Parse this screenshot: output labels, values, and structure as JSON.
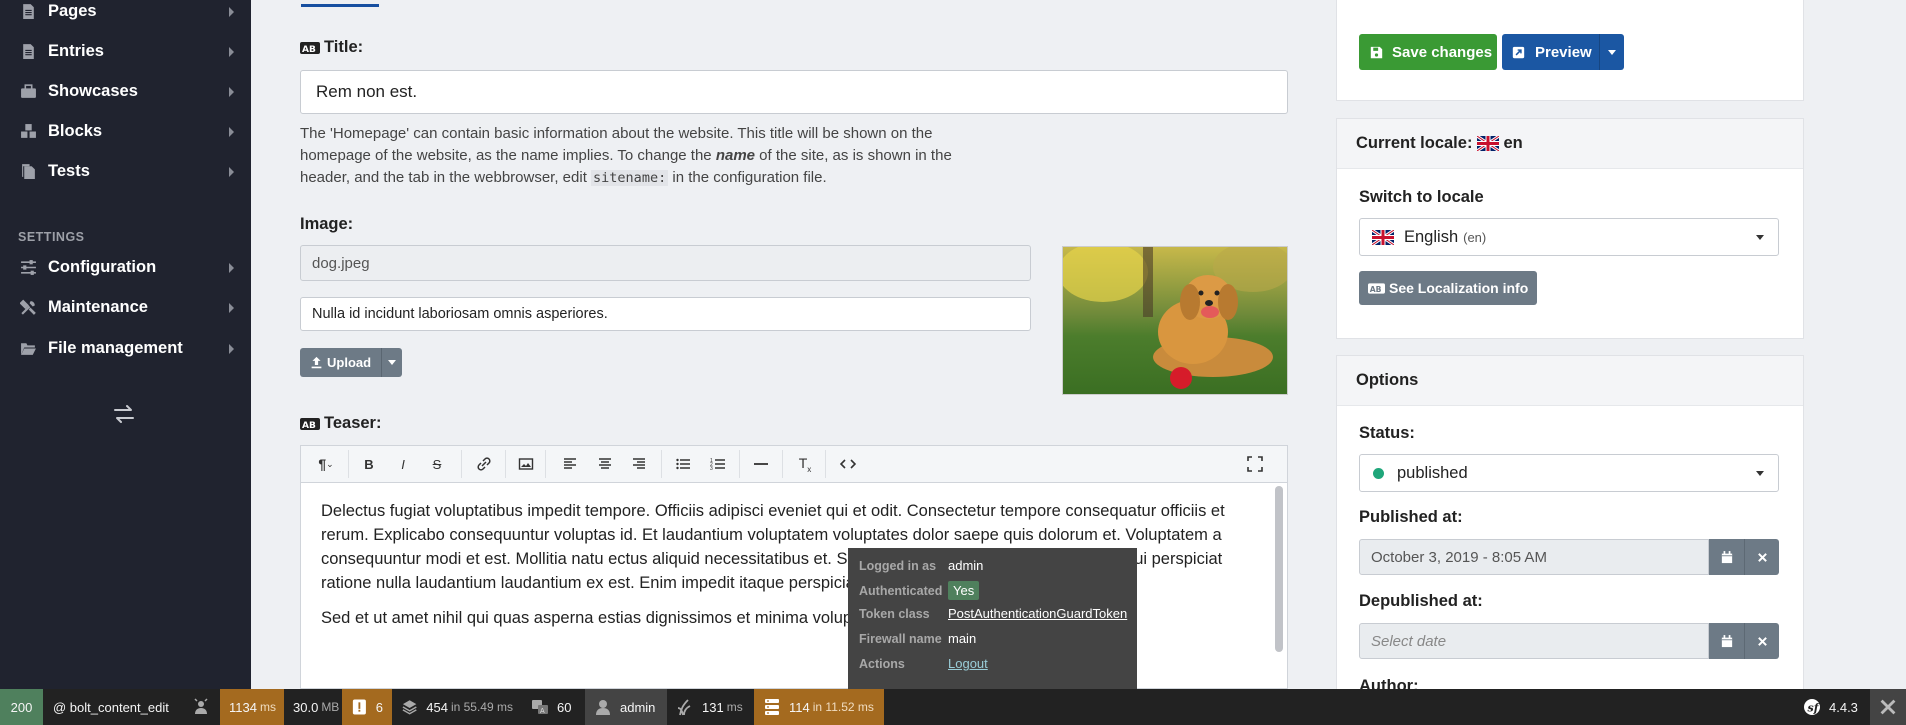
{
  "sidebar": {
    "items": [
      {
        "label": "Pages",
        "icon": "pages-icon"
      },
      {
        "label": "Entries",
        "icon": "entries-icon"
      },
      {
        "label": "Showcases",
        "icon": "showcases-icon"
      },
      {
        "label": "Blocks",
        "icon": "blocks-icon"
      },
      {
        "label": "Tests",
        "icon": "tests-icon"
      }
    ],
    "settings_header": "SETTINGS",
    "settings_items": [
      {
        "label": "Configuration",
        "icon": "sliders-icon"
      },
      {
        "label": "Maintenance",
        "icon": "tools-icon"
      },
      {
        "label": "File management",
        "icon": "folder-open-icon"
      }
    ]
  },
  "form": {
    "title_label": "Title:",
    "title_value": "Rem non est.",
    "help_parts": {
      "p1": "The 'Homepage' can contain basic information about the website. This title will be shown on the homepage of the website, as the name implies. To change the ",
      "em": "name",
      "p2": " of the site, as is shown in the header, and the tab in the webbrowser, edit ",
      "code": "sitename:",
      "p3": " in the configuration file."
    },
    "image_label": "Image:",
    "image_filename": "dog.jpeg",
    "image_alt": "Nulla id incidunt laboriosam omnis asperiores.",
    "upload_label": "Upload",
    "teaser_label": "Teaser:",
    "teaser_p1": "Delectus fugiat voluptatibus impedit tempore. Officiis adipisci eveniet qui et odit. Consectetur tempore consequatur officiis et rerum. Explicabo consequuntur voluptas id. Et laudantium voluptatem voluptates dolor saepe quis dolorum et. Voluptatem a consequuntur modi et est. Mollitia natu",
    "teaser_p1b": "ectus aliquid necessitatibus et. Sit est sit vero officia quam modi. Dicta qui perspiciat",
    "teaser_p1c": " ratione nulla laudantium laudantium ex est. Enim impedit itaque perspiciatis. Sit suscipit",
    "teaser_p2": "Sed et ut amet nihil qui quas asperna",
    "teaser_p2b": "estias dignissimos et minima voluptas praesentium ut officiis quia."
  },
  "actions": {
    "save_label": "Save changes",
    "preview_label": "Preview"
  },
  "locale": {
    "current_label": "Current locale:",
    "current_code": "en",
    "switch_label": "Switch to locale",
    "selected_language": "English",
    "selected_code": "(en)",
    "info_button": "See Localization info"
  },
  "options": {
    "header": "Options",
    "status_label": "Status:",
    "status_value": "published",
    "status_color": "#1fa67a",
    "published_label": "Published at:",
    "published_value": "October 3, 2019 - 8:05 AM",
    "depublished_label": "Depublished at:",
    "depublished_placeholder": "Select date",
    "author_label": "Author:"
  },
  "tooltip": {
    "rows": [
      {
        "key": "Logged in as",
        "value": "admin"
      },
      {
        "key": "Authenticated",
        "value": "Yes"
      },
      {
        "key": "Token class",
        "value": "PostAuthenticationGuardToken"
      },
      {
        "key": "Firewall name",
        "value": "main"
      },
      {
        "key": "Actions",
        "value": "Logout"
      }
    ]
  },
  "debug_bar": {
    "status": "200",
    "route": "@ bolt_content_edit",
    "time": "1134",
    "time_unit": "ms",
    "memory": "30.0",
    "memory_unit": "MB",
    "logs": "6",
    "cache_count": "454",
    "cache_time": "in 55.49 ms",
    "translations": "60",
    "user": "admin",
    "twig_time": "131",
    "twig_unit": "ms",
    "db_queries": "114",
    "db_time": "in 11.52 ms",
    "version": "4.4.3"
  }
}
